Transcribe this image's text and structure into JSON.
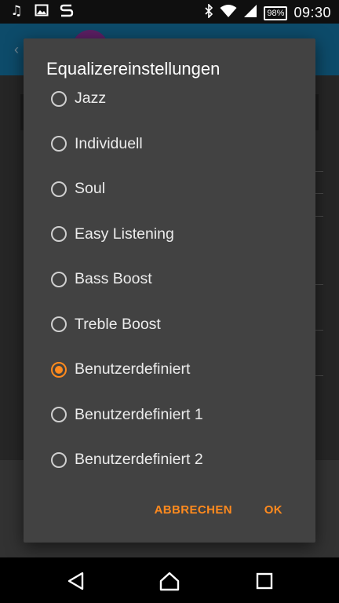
{
  "status_bar": {
    "left_icons": [
      "music-note-icon",
      "image-icon",
      "app-s-icon"
    ],
    "right_icons": [
      "bluetooth-icon",
      "wifi-icon",
      "signal-icon"
    ],
    "battery": "98%",
    "time": "09:30"
  },
  "dialog": {
    "title": "Equalizereinstellungen",
    "options": [
      {
        "label": "Jazz",
        "checked": false
      },
      {
        "label": "Individuell",
        "checked": false
      },
      {
        "label": "Soul",
        "checked": false
      },
      {
        "label": "Easy Listening",
        "checked": false
      },
      {
        "label": "Bass Boost",
        "checked": false
      },
      {
        "label": "Treble Boost",
        "checked": false
      },
      {
        "label": "Benutzerdefiniert",
        "checked": true
      },
      {
        "label": "Benutzerdefiniert 1",
        "checked": false
      },
      {
        "label": "Benutzerdefiniert 2",
        "checked": false
      }
    ],
    "cancel_label": "ABBRECHEN",
    "ok_label": "OK"
  },
  "colors": {
    "accent": "#ff8a1e",
    "dialog_bg": "#424242",
    "status_bar_bg": "#0f0f0f"
  },
  "nav_bar": {
    "icons": [
      "back-icon",
      "home-icon",
      "recents-icon"
    ]
  }
}
